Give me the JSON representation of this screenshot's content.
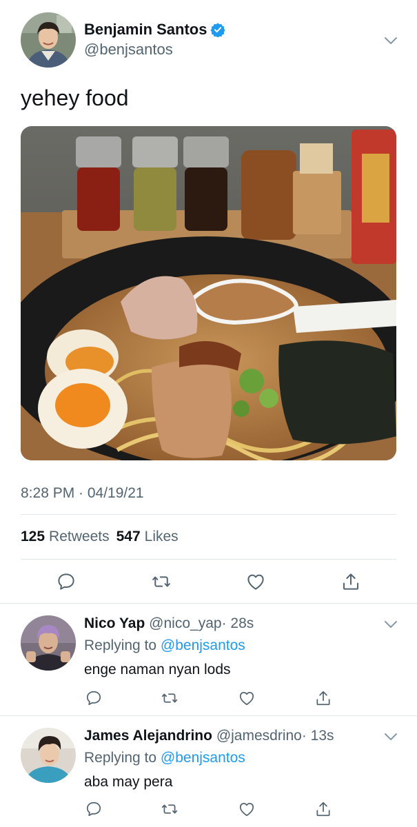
{
  "main_tweet": {
    "author_name": "Benjamin Santos",
    "author_handle": "@benjsantos",
    "verified": true,
    "text": "yehey food",
    "photo_icon": "ramen-bowl-photo",
    "timestamp": "8:28 PM · 04/19/21",
    "retweets_count": "125",
    "retweets_label": "Retweets",
    "likes_count": "547",
    "likes_label": "Likes",
    "actions": [
      "reply-icon",
      "retweet-icon",
      "like-icon",
      "share-icon"
    ]
  },
  "replies": [
    {
      "author_name": "Nico Yap",
      "author_handle": "@nico_yap",
      "time_ago": "· 28s",
      "replying_prefix": "Replying to",
      "replying_to": "@benjsantos",
      "text": "enge naman nyan lods"
    },
    {
      "author_name": "James Alejandrino",
      "author_handle": "@jamesdrino",
      "time_ago": "· 13s",
      "replying_prefix": "Replying to",
      "replying_to": "@benjsantos",
      "text": "aba may pera"
    }
  ],
  "colors": {
    "text_primary": "#0f1419",
    "text_secondary": "#536471",
    "accent": "#1d9bf0",
    "divider": "#e1e8ed"
  }
}
